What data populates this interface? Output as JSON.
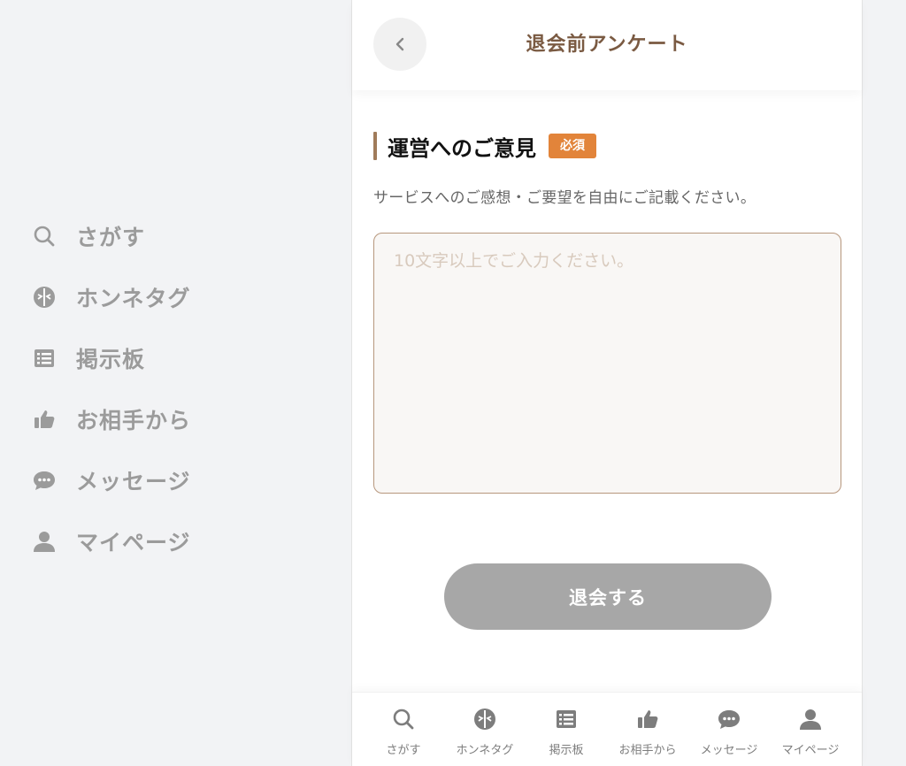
{
  "colors": {
    "icon_gray": "#9b9b9b",
    "brand_brown": "#7a5a42",
    "required_orange": "#e2843a",
    "button_gray": "#a7a7a7"
  },
  "side_nav": {
    "items": [
      {
        "label": "さがす",
        "icon": "search-icon"
      },
      {
        "label": "ホンネタグ",
        "icon": "tag-circle-icon"
      },
      {
        "label": "掲示板",
        "icon": "board-list-icon"
      },
      {
        "label": "お相手から",
        "icon": "thumbs-up-icon"
      },
      {
        "label": "メッセージ",
        "icon": "chat-bubble-icon"
      },
      {
        "label": "マイページ",
        "icon": "person-icon"
      }
    ]
  },
  "header": {
    "title": "退会前アンケート",
    "back_icon": "chevron-left-icon"
  },
  "form": {
    "heading": "運営へのご意見",
    "required_badge": "必須",
    "description": "サービスへのご感想・ご要望を自由にご記載ください。",
    "textarea_placeholder": "10文字以上でご入力ください。",
    "textarea_value": "",
    "submit_label": "退会する"
  },
  "tab_bar": {
    "items": [
      {
        "label": "さがす",
        "icon": "search-icon"
      },
      {
        "label": "ホンネタグ",
        "icon": "tag-circle-icon"
      },
      {
        "label": "掲示板",
        "icon": "board-list-icon"
      },
      {
        "label": "お相手から",
        "icon": "thumbs-up-icon"
      },
      {
        "label": "メッセージ",
        "icon": "chat-bubble-icon"
      },
      {
        "label": "マイページ",
        "icon": "person-icon"
      }
    ]
  }
}
